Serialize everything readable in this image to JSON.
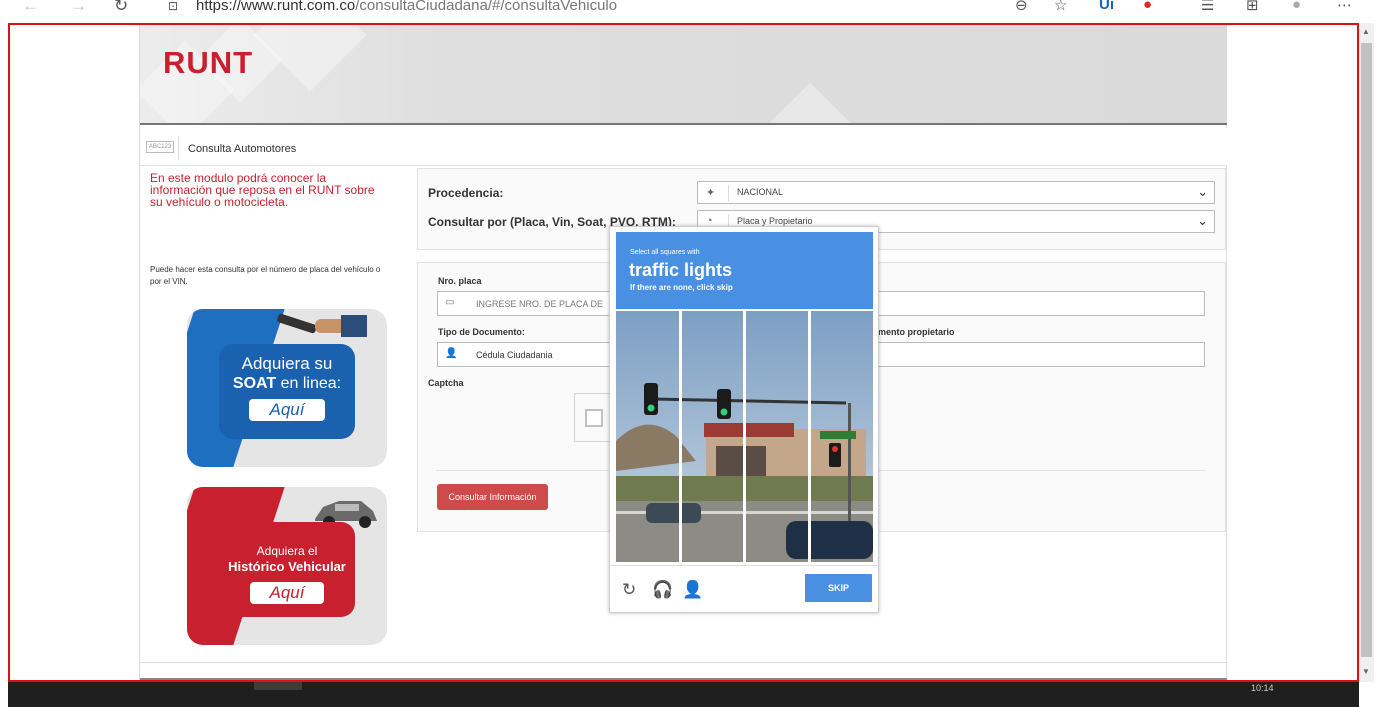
{
  "browser": {
    "url_host": "https://www.runt.com.co",
    "url_path": "/consultaCiudadana/#/consultaVehiculo"
  },
  "site": {
    "logo": "RUNT",
    "crumb_icon_text": "ABC123",
    "crumb": "Consulta Automotores",
    "intro": "En este modulo podrá conocer la información que reposa en el RUNT sobre su vehículo o motocicleta.",
    "help": "Puede hacer esta consulta por el número de placa del vehículo o por el VIN."
  },
  "soat_banner": {
    "line1": "Adquiera su",
    "line2_bold": "SOAT",
    "line2_rest": " en linea:",
    "button": "Aquí"
  },
  "historico_banner": {
    "line1": "Adquiera el",
    "line2": "Histórico Vehicular",
    "button": "Aquí"
  },
  "form": {
    "procedencia_label": "Procedencia:",
    "procedencia_value": "NACIONAL",
    "consultar_por_label": "Consultar por (Placa, Vin, Soat, PVO, RTM):",
    "consultar_por_value": "Placa y Propietario",
    "placa_label": "Nro. placa",
    "placa_placeholder": "INGRESE NRO. DE PLACA DE",
    "tipo_doc_label": "Tipo de Documento:",
    "tipo_doc_value": "Cédula Ciudadania",
    "doc_propietario_label": "mento propietario",
    "captcha_label": "Captcha",
    "submit": "Consultar Información"
  },
  "recaptcha": {
    "line1": "Select all squares with",
    "keyword": "traffic lights",
    "line3": "If there are none, click skip",
    "skip": "SKIP"
  },
  "system": {
    "clock": "10:14"
  },
  "colors": {
    "brand_red": "#c8202f",
    "recaptcha_blue": "#4a90e2",
    "soat_blue": "#1a62b0"
  }
}
